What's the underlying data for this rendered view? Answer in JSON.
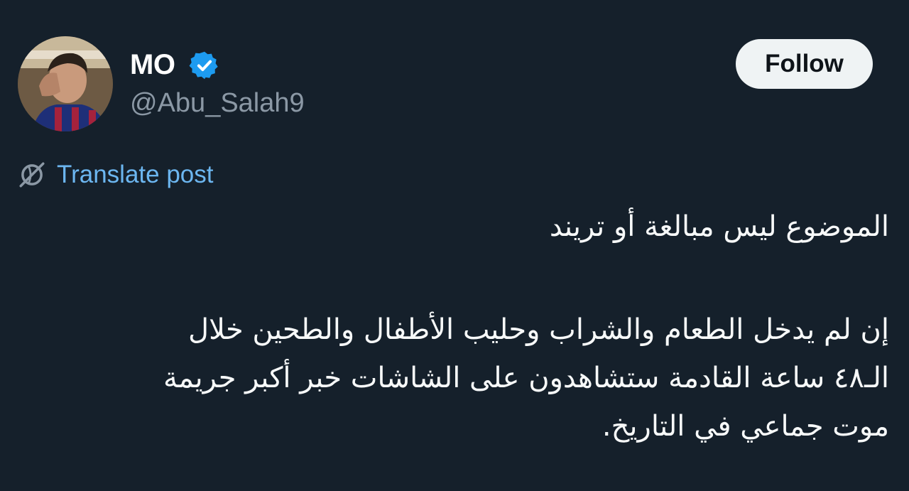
{
  "author": {
    "display_name": "MO",
    "handle": "@Abu_Salah9",
    "verified": true
  },
  "follow_label": "Follow",
  "translate_label": "Translate post",
  "post": {
    "line_1": "الموضوع ليس مبالغة أو تريند",
    "paragraph_2_lines": [
      "إن لم يدخل الطعام والشراب وحليب الأطفال والطحين خلال",
      "الـ٤٨ ساعة القادمة ستشاهدون على الشاشات خبر أكبر جريمة",
      "موت جماعي في التاريخ."
    ]
  },
  "colors": {
    "background": "#15202b",
    "handle": "#8b98a5",
    "link": "#6cb6f0",
    "verified_badge": "#1d9bf0",
    "follow_button_bg": "#eff3f4",
    "follow_button_text": "#0f1419"
  },
  "icons": {
    "verified": "verified-badge-icon",
    "translate": "translate-globe-icon"
  }
}
